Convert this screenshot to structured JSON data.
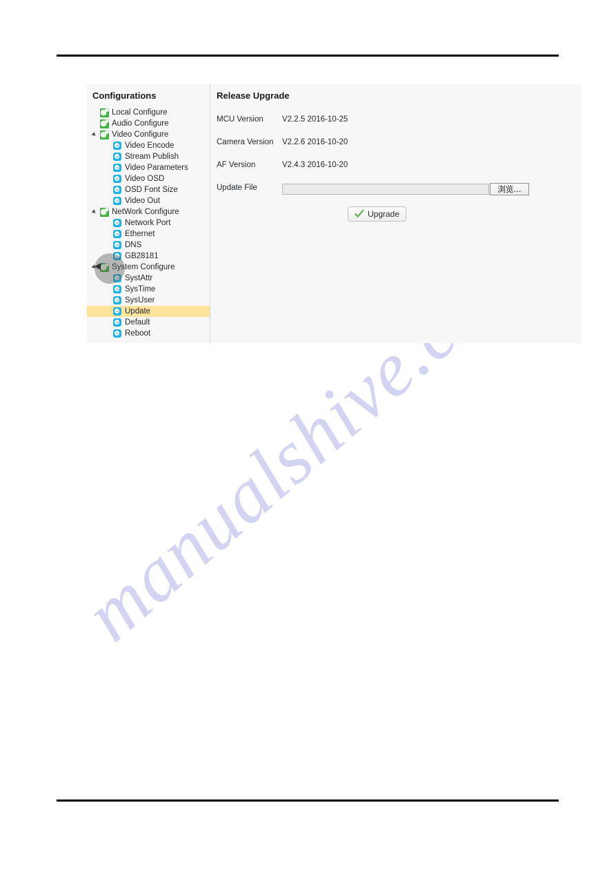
{
  "watermark": {
    "text": "manualshive.com"
  },
  "sidebar": {
    "title": "Configurations",
    "items": [
      {
        "label": "Local Configure",
        "level": 1,
        "icon": "green-gear-icon",
        "twisty": false,
        "selected": false
      },
      {
        "label": "Audio Configure",
        "level": 1,
        "icon": "green-gear-icon",
        "twisty": false,
        "selected": false
      },
      {
        "label": "Video Configure",
        "level": 1,
        "icon": "green-gear-icon",
        "twisty": true,
        "selected": false
      },
      {
        "label": "Video Encode",
        "level": 2,
        "icon": "blue-gear-icon",
        "twisty": false,
        "selected": false
      },
      {
        "label": "Stream Publish",
        "level": 2,
        "icon": "blue-gear-icon",
        "twisty": false,
        "selected": false
      },
      {
        "label": "Video Parameters",
        "level": 2,
        "icon": "blue-gear-icon",
        "twisty": false,
        "selected": false
      },
      {
        "label": "Video OSD",
        "level": 2,
        "icon": "blue-gear-icon",
        "twisty": false,
        "selected": false
      },
      {
        "label": "OSD Font Size",
        "level": 2,
        "icon": "blue-gear-icon",
        "twisty": false,
        "selected": false
      },
      {
        "label": "Video Out",
        "level": 2,
        "icon": "blue-gear-icon",
        "twisty": false,
        "selected": false
      },
      {
        "label": "NetWork Configure",
        "level": 1,
        "icon": "green-gear-icon",
        "twisty": true,
        "selected": false
      },
      {
        "label": "Network Port",
        "level": 2,
        "icon": "blue-gear-icon",
        "twisty": false,
        "selected": false
      },
      {
        "label": "Ethernet",
        "level": 2,
        "icon": "blue-gear-icon",
        "twisty": false,
        "selected": false
      },
      {
        "label": "DNS",
        "level": 2,
        "icon": "blue-gear-icon",
        "twisty": false,
        "selected": false
      },
      {
        "label": "GB28181",
        "level": 2,
        "icon": "blue-gear-icon",
        "twisty": false,
        "selected": false
      },
      {
        "label": "System Configure",
        "level": 1,
        "icon": "green-gear-icon",
        "twisty": true,
        "selected": false
      },
      {
        "label": "SystAttr",
        "level": 2,
        "icon": "blue-gear-icon",
        "twisty": false,
        "selected": false
      },
      {
        "label": "SysTime",
        "level": 2,
        "icon": "blue-gear-icon",
        "twisty": false,
        "selected": false
      },
      {
        "label": "SysUser",
        "level": 2,
        "icon": "blue-gear-icon",
        "twisty": false,
        "selected": false
      },
      {
        "label": "Update",
        "level": 2,
        "icon": "blue-gear-icon",
        "twisty": false,
        "selected": true
      },
      {
        "label": "Default",
        "level": 2,
        "icon": "blue-gear-icon",
        "twisty": false,
        "selected": false
      },
      {
        "label": "Reboot",
        "level": 2,
        "icon": "blue-gear-icon",
        "twisty": false,
        "selected": false
      }
    ],
    "selected_highlight_color": "#fde49a"
  },
  "content": {
    "title": "Release Upgrade",
    "fields": [
      {
        "label": "MCU Version",
        "value": "V2.2.5 2016-10-25"
      },
      {
        "label": "Camera Version",
        "value": "V2.2.6 2016-10-20"
      },
      {
        "label": "AF Version",
        "value": "V2.4.3 2016-10-20"
      }
    ],
    "update_file": {
      "label": "Update File",
      "value": "",
      "placeholder": "",
      "browse_label": "浏览..."
    },
    "upgrade_button": {
      "label": "Upgrade",
      "icon": "check-icon",
      "icon_color": "#4a9b3f"
    }
  }
}
